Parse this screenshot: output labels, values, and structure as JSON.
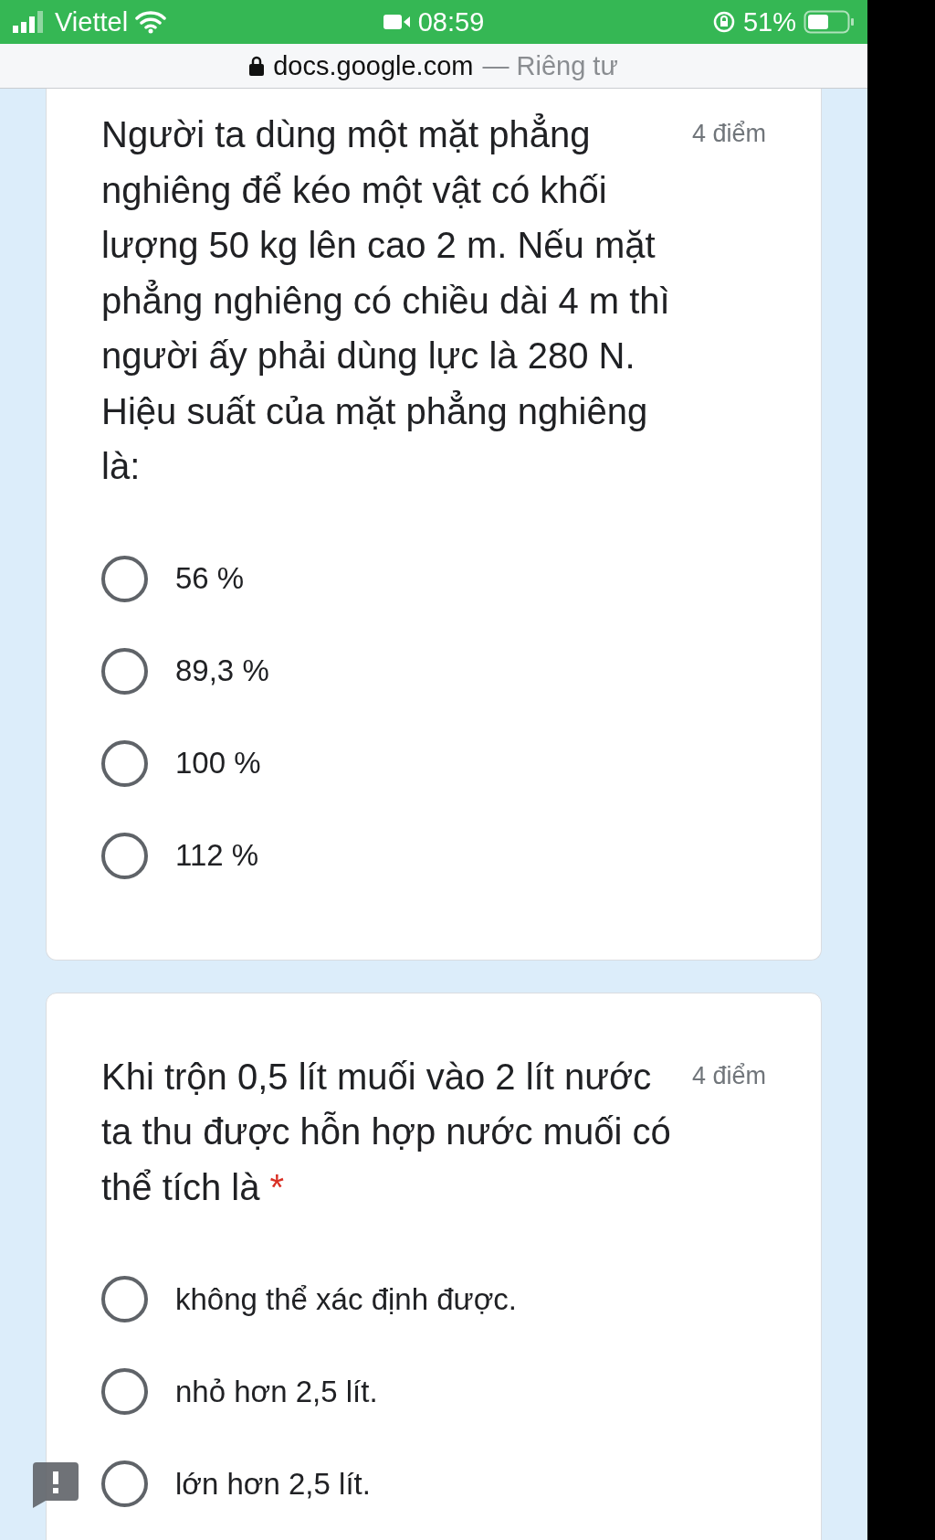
{
  "status_bar": {
    "carrier": "Viettel",
    "time": "08:59",
    "battery": "51%"
  },
  "address_bar": {
    "domain": "docs.google.com",
    "privacy": "— Riêng tư"
  },
  "questions": [
    {
      "text": "Người ta dùng một mặt phẳng nghiêng để kéo một vật có khối lượng 50 kg lên cao 2 m. Nếu mặt phẳng nghiêng có chiều dài 4 m thì người ấy phải dùng lực là 280 N. Hiệu suất của mặt phẳng nghiêng là:",
      "points": "4 điểm",
      "required": false,
      "options": [
        {
          "label": "56 %",
          "selected": false
        },
        {
          "label": "89,3 %",
          "selected": false
        },
        {
          "label": "100 %",
          "selected": false
        },
        {
          "label": "112 %",
          "selected": false
        }
      ]
    },
    {
      "text": "Khi trộn 0,5 lít muối vào 2 lít nước ta thu được hỗn hợp nước muối có thể tích là",
      "points": "4 điểm",
      "required": true,
      "required_mark": "*",
      "options": [
        {
          "label": "không thể xác định được.",
          "selected": false
        },
        {
          "label": "nhỏ hơn 2,5 lít.",
          "selected": false
        },
        {
          "label": "lớn hơn 2,5 lít.",
          "selected": false
        }
      ]
    }
  ]
}
